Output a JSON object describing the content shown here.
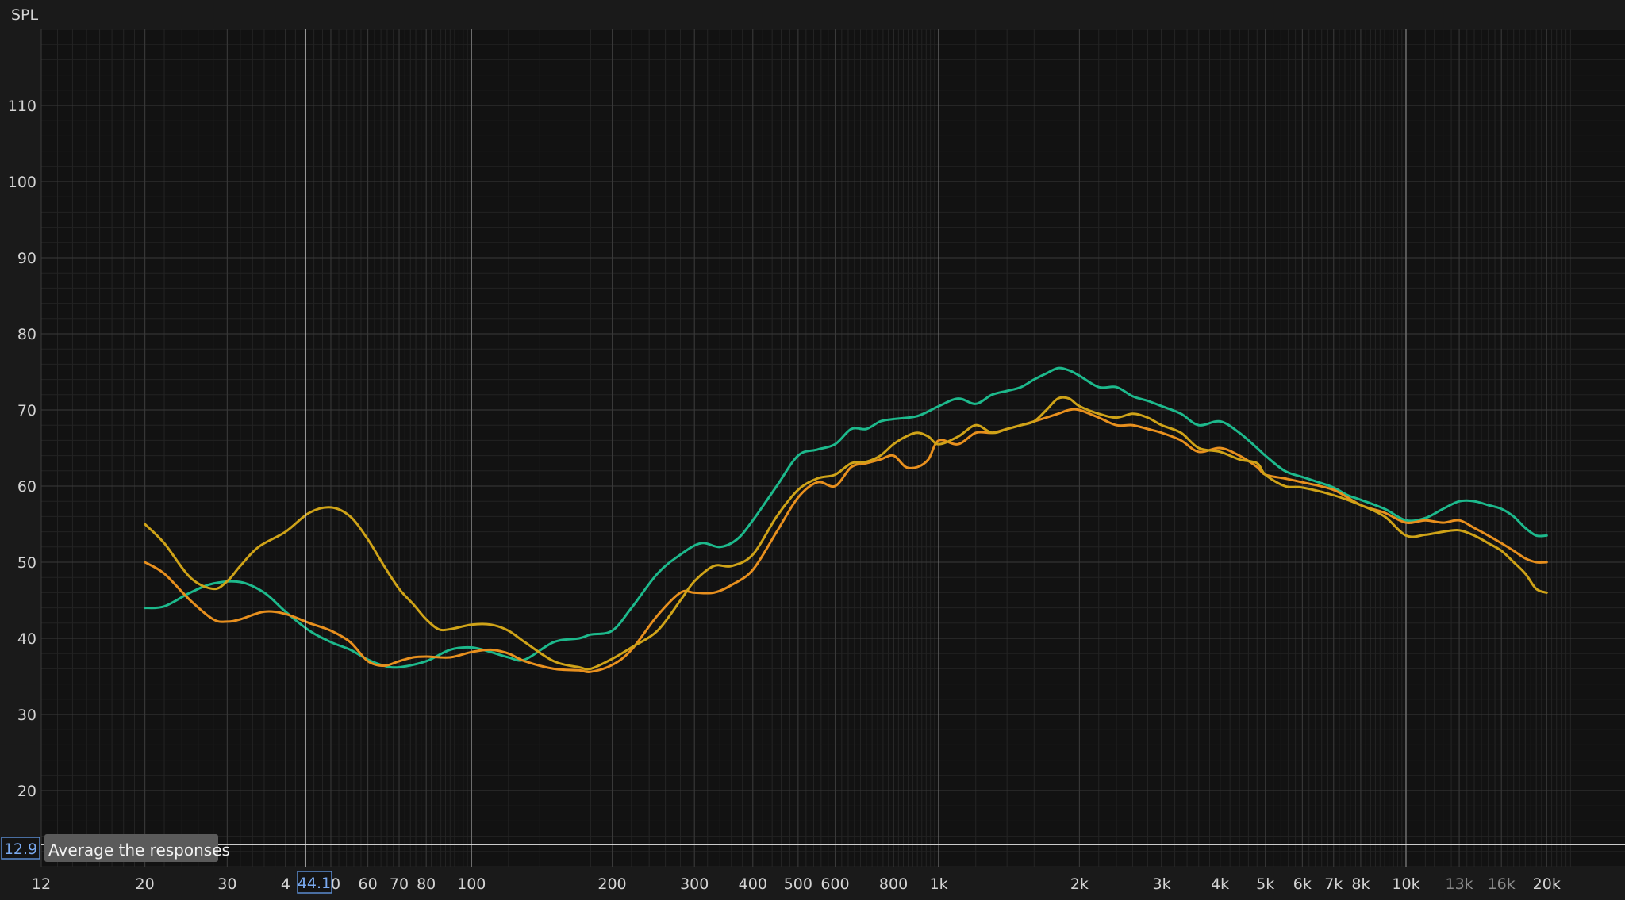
{
  "app": {
    "tooltip": "Average the responses"
  },
  "cursor": {
    "x_label": "44.1",
    "y_label": "12.9",
    "x_value": 44.1,
    "y_value": 12.9
  },
  "chart_data": {
    "type": "line",
    "ylabel": "SPL",
    "xscale": "log",
    "xlim": [
      12,
      23000
    ],
    "ylim": [
      10,
      120
    ],
    "y_ticks": [
      20,
      30,
      40,
      50,
      60,
      70,
      80,
      90,
      100,
      110
    ],
    "x_ticks": [
      {
        "v": 12,
        "label": "12"
      },
      {
        "v": 20,
        "label": "20"
      },
      {
        "v": 30,
        "label": "30"
      },
      {
        "v": 40,
        "label": "4"
      },
      {
        "v": 50,
        "label": "50"
      },
      {
        "v": 60,
        "label": "60"
      },
      {
        "v": 70,
        "label": "70"
      },
      {
        "v": 80,
        "label": "80"
      },
      {
        "v": 100,
        "label": "100"
      },
      {
        "v": 200,
        "label": "200"
      },
      {
        "v": 300,
        "label": "300"
      },
      {
        "v": 400,
        "label": "400"
      },
      {
        "v": 500,
        "label": "500"
      },
      {
        "v": 600,
        "label": "600"
      },
      {
        "v": 800,
        "label": "800"
      },
      {
        "v": 1000,
        "label": "1k"
      },
      {
        "v": 2000,
        "label": "2k"
      },
      {
        "v": 3000,
        "label": "3k"
      },
      {
        "v": 4000,
        "label": "4k"
      },
      {
        "v": 5000,
        "label": "5k"
      },
      {
        "v": 6000,
        "label": "6k"
      },
      {
        "v": 7000,
        "label": "7k"
      },
      {
        "v": 8000,
        "label": "8k"
      },
      {
        "v": 10000,
        "label": "10k"
      },
      {
        "v": 13000,
        "label": "13k",
        "dim": true
      },
      {
        "v": 16000,
        "label": "16k",
        "dim": true
      },
      {
        "v": 20000,
        "label": "20k"
      }
    ],
    "series": [
      {
        "color": "#1db98c",
        "points": [
          [
            20,
            44
          ],
          [
            22,
            44.2
          ],
          [
            25,
            46
          ],
          [
            28,
            47.2
          ],
          [
            32,
            47.4
          ],
          [
            36,
            46
          ],
          [
            40,
            43.5
          ],
          [
            45,
            41
          ],
          [
            50,
            39.5
          ],
          [
            55,
            38.5
          ],
          [
            60,
            37.2
          ],
          [
            65,
            36.4
          ],
          [
            70,
            36.2
          ],
          [
            80,
            37
          ],
          [
            90,
            38.5
          ],
          [
            100,
            38.8
          ],
          [
            110,
            38.2
          ],
          [
            120,
            37.5
          ],
          [
            130,
            37.2
          ],
          [
            150,
            39.5
          ],
          [
            170,
            40
          ],
          [
            180,
            40.5
          ],
          [
            200,
            41
          ],
          [
            220,
            44
          ],
          [
            250,
            48.5
          ],
          [
            280,
            51
          ],
          [
            310,
            52.5
          ],
          [
            340,
            52
          ],
          [
            370,
            53
          ],
          [
            400,
            55.5
          ],
          [
            450,
            60
          ],
          [
            500,
            64
          ],
          [
            550,
            64.8
          ],
          [
            600,
            65.5
          ],
          [
            650,
            67.5
          ],
          [
            700,
            67.5
          ],
          [
            750,
            68.5
          ],
          [
            800,
            68.8
          ],
          [
            900,
            69.2
          ],
          [
            1000,
            70.5
          ],
          [
            1100,
            71.5
          ],
          [
            1200,
            70.8
          ],
          [
            1300,
            72
          ],
          [
            1400,
            72.5
          ],
          [
            1500,
            73
          ],
          [
            1600,
            74
          ],
          [
            1700,
            74.8
          ],
          [
            1800,
            75.5
          ],
          [
            1900,
            75.2
          ],
          [
            2000,
            74.5
          ],
          [
            2200,
            73
          ],
          [
            2400,
            73
          ],
          [
            2600,
            71.8
          ],
          [
            2800,
            71.2
          ],
          [
            3000,
            70.5
          ],
          [
            3300,
            69.5
          ],
          [
            3600,
            68
          ],
          [
            4000,
            68.5
          ],
          [
            4400,
            67
          ],
          [
            4800,
            65
          ],
          [
            5000,
            64
          ],
          [
            5500,
            62
          ],
          [
            6000,
            61.2
          ],
          [
            6500,
            60.5
          ],
          [
            7000,
            59.8
          ],
          [
            7500,
            58.8
          ],
          [
            8000,
            58.2
          ],
          [
            9000,
            57
          ],
          [
            10000,
            55.5
          ],
          [
            11000,
            55.8
          ],
          [
            12000,
            57
          ],
          [
            13000,
            58
          ],
          [
            14000,
            58
          ],
          [
            15000,
            57.5
          ],
          [
            16000,
            57
          ],
          [
            17000,
            56
          ],
          [
            18000,
            54.5
          ],
          [
            19000,
            53.5
          ],
          [
            20000,
            53.5
          ]
        ]
      },
      {
        "color": "#e8901e",
        "points": [
          [
            20,
            50
          ],
          [
            22,
            48.5
          ],
          [
            25,
            45
          ],
          [
            28,
            42.5
          ],
          [
            30,
            42.2
          ],
          [
            32,
            42.5
          ],
          [
            36,
            43.5
          ],
          [
            40,
            43.2
          ],
          [
            45,
            42
          ],
          [
            50,
            41
          ],
          [
            55,
            39.5
          ],
          [
            60,
            37
          ],
          [
            65,
            36.4
          ],
          [
            70,
            37
          ],
          [
            75,
            37.5
          ],
          [
            80,
            37.6
          ],
          [
            90,
            37.5
          ],
          [
            100,
            38.2
          ],
          [
            110,
            38.5
          ],
          [
            120,
            38
          ],
          [
            130,
            37
          ],
          [
            150,
            36
          ],
          [
            170,
            35.8
          ],
          [
            180,
            35.6
          ],
          [
            200,
            36.5
          ],
          [
            220,
            38.5
          ],
          [
            250,
            43
          ],
          [
            280,
            46
          ],
          [
            300,
            46
          ],
          [
            330,
            46
          ],
          [
            360,
            47
          ],
          [
            400,
            49
          ],
          [
            450,
            54
          ],
          [
            500,
            58.5
          ],
          [
            550,
            60.5
          ],
          [
            600,
            60
          ],
          [
            650,
            62.5
          ],
          [
            700,
            63
          ],
          [
            750,
            63.5
          ],
          [
            800,
            64
          ],
          [
            850,
            62.5
          ],
          [
            900,
            62.5
          ],
          [
            950,
            63.5
          ],
          [
            1000,
            66
          ],
          [
            1100,
            65.5
          ],
          [
            1200,
            67
          ],
          [
            1300,
            67
          ],
          [
            1400,
            67.5
          ],
          [
            1500,
            68
          ],
          [
            1600,
            68.5
          ],
          [
            1800,
            69.5
          ],
          [
            1900,
            70
          ],
          [
            2000,
            70
          ],
          [
            2200,
            69
          ],
          [
            2400,
            68
          ],
          [
            2600,
            68
          ],
          [
            2800,
            67.5
          ],
          [
            3000,
            67
          ],
          [
            3300,
            66
          ],
          [
            3600,
            64.5
          ],
          [
            4000,
            65
          ],
          [
            4400,
            64
          ],
          [
            4800,
            62.5
          ],
          [
            5000,
            61.5
          ],
          [
            5500,
            61
          ],
          [
            6000,
            60.5
          ],
          [
            7000,
            59.5
          ],
          [
            8000,
            57.5
          ],
          [
            9000,
            56.5
          ],
          [
            10000,
            55.2
          ],
          [
            11000,
            55.5
          ],
          [
            12000,
            55.2
          ],
          [
            13000,
            55.5
          ],
          [
            14000,
            54.5
          ],
          [
            15000,
            53.5
          ],
          [
            16000,
            52.5
          ],
          [
            17000,
            51.5
          ],
          [
            18000,
            50.5
          ],
          [
            19000,
            50
          ],
          [
            20000,
            50
          ]
        ]
      },
      {
        "color": "#cfa318",
        "points": [
          [
            20,
            55
          ],
          [
            22,
            52.5
          ],
          [
            25,
            48
          ],
          [
            28,
            46.5
          ],
          [
            30,
            47.5
          ],
          [
            32,
            49.5
          ],
          [
            35,
            52
          ],
          [
            40,
            54
          ],
          [
            45,
            56.5
          ],
          [
            50,
            57.2
          ],
          [
            55,
            56
          ],
          [
            60,
            53
          ],
          [
            65,
            49.5
          ],
          [
            70,
            46.5
          ],
          [
            75,
            44.5
          ],
          [
            80,
            42.5
          ],
          [
            85,
            41.2
          ],
          [
            90,
            41.2
          ],
          [
            100,
            41.8
          ],
          [
            110,
            41.8
          ],
          [
            120,
            41
          ],
          [
            130,
            39.5
          ],
          [
            150,
            37
          ],
          [
            170,
            36.2
          ],
          [
            180,
            36
          ],
          [
            200,
            37.3
          ],
          [
            220,
            38.8
          ],
          [
            250,
            41
          ],
          [
            280,
            45
          ],
          [
            300,
            47.5
          ],
          [
            330,
            49.5
          ],
          [
            360,
            49.5
          ],
          [
            400,
            51
          ],
          [
            450,
            56
          ],
          [
            500,
            59.5
          ],
          [
            550,
            61
          ],
          [
            600,
            61.5
          ],
          [
            650,
            63
          ],
          [
            700,
            63.2
          ],
          [
            750,
            64
          ],
          [
            800,
            65.5
          ],
          [
            850,
            66.5
          ],
          [
            900,
            67
          ],
          [
            950,
            66.5
          ],
          [
            1000,
            65.5
          ],
          [
            1100,
            66.5
          ],
          [
            1200,
            68
          ],
          [
            1300,
            67
          ],
          [
            1400,
            67.5
          ],
          [
            1500,
            68
          ],
          [
            1600,
            68.5
          ],
          [
            1700,
            70
          ],
          [
            1800,
            71.5
          ],
          [
            1900,
            71.5
          ],
          [
            2000,
            70.5
          ],
          [
            2200,
            69.5
          ],
          [
            2400,
            69
          ],
          [
            2600,
            69.5
          ],
          [
            2800,
            69
          ],
          [
            3000,
            68
          ],
          [
            3300,
            67
          ],
          [
            3600,
            65
          ],
          [
            4000,
            64.5
          ],
          [
            4400,
            63.5
          ],
          [
            4800,
            63
          ],
          [
            5000,
            61.5
          ],
          [
            5500,
            60
          ],
          [
            6000,
            59.8
          ],
          [
            7000,
            58.8
          ],
          [
            8000,
            57.5
          ],
          [
            9000,
            56
          ],
          [
            10000,
            53.5
          ],
          [
            11000,
            53.6
          ],
          [
            12000,
            54
          ],
          [
            13000,
            54.2
          ],
          [
            14000,
            53.5
          ],
          [
            15000,
            52.5
          ],
          [
            16000,
            51.5
          ],
          [
            17000,
            50
          ],
          [
            18000,
            48.5
          ],
          [
            19000,
            46.5
          ],
          [
            20000,
            46
          ]
        ]
      }
    ]
  }
}
